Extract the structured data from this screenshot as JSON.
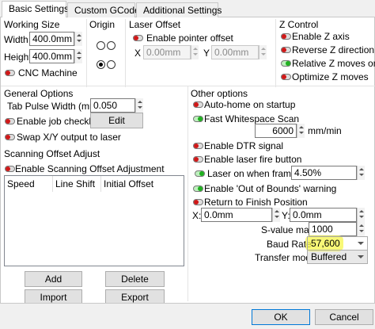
{
  "tabs": [
    {
      "label": "Basic Settings",
      "active": true
    },
    {
      "label": "Custom GCode",
      "active": false
    },
    {
      "label": "Additional Settings",
      "active": false
    }
  ],
  "working_size": {
    "title": "Working Size",
    "width_label": "Width",
    "width_value": "400.0mm",
    "height_label": "Height",
    "height_value": "400.0mm",
    "cnc_label": "CNC Machine",
    "cnc_on": false
  },
  "origin": {
    "title": "Origin",
    "selected": "bottom-left"
  },
  "laser_offset": {
    "title": "Laser Offset",
    "pointer_label": "Enable pointer offset",
    "x_label": "X",
    "x_value": "0.00mm",
    "y_label": "Y",
    "y_value": "0.00mm"
  },
  "z_control": {
    "title": "Z Control",
    "items": [
      {
        "label": "Enable Z axis",
        "on": false
      },
      {
        "label": "Reverse Z direction",
        "on": false
      },
      {
        "label": "Relative Z moves only",
        "on": true
      },
      {
        "label": "Optimize Z moves",
        "on": false
      }
    ]
  },
  "general": {
    "title": "General Options",
    "tab_pulse_label": "Tab Pulse Width (mm)",
    "tab_pulse_value": "0.050",
    "job_checklist_label": "Enable job checklist",
    "edit_label": "Edit",
    "swap_label": "Swap X/Y output to laser"
  },
  "scanning": {
    "title": "Scanning Offset Adjust",
    "enable_label": "Enable Scanning Offset Adjustment",
    "columns": [
      "Speed",
      "Line Shift",
      "Initial Offset"
    ],
    "add_label": "Add",
    "delete_label": "Delete",
    "import_label": "Import",
    "export_label": "Export"
  },
  "other": {
    "title": "Other options",
    "autohome_label": "Auto-home on startup",
    "fast_scan_label": "Fast Whitespace Scan",
    "speed_value": "6000",
    "speed_unit": "mm/min",
    "dtr_label": "Enable DTR signal",
    "fire_label": "Enable laser fire button",
    "framing_label": "Laser on when framing",
    "framing_value": "4.50%",
    "oob_label": "Enable 'Out of Bounds' warning",
    "return_label": "Return to Finish Position",
    "x_label": "X:",
    "x_value": "0.0mm",
    "y_label": "Y:",
    "y_value": "0.0mm",
    "svalue_label": "S-value max",
    "svalue_value": "1000",
    "baud_label": "Baud Rate",
    "baud_value": "57,600",
    "transfer_label": "Transfer mode",
    "transfer_value": "Buffered"
  },
  "footer": {
    "ok_label": "OK",
    "cancel_label": "Cancel"
  },
  "colors": {
    "toggle_off": "#d01818",
    "toggle_on": "#20b020",
    "highlight": "#f6f64a"
  }
}
